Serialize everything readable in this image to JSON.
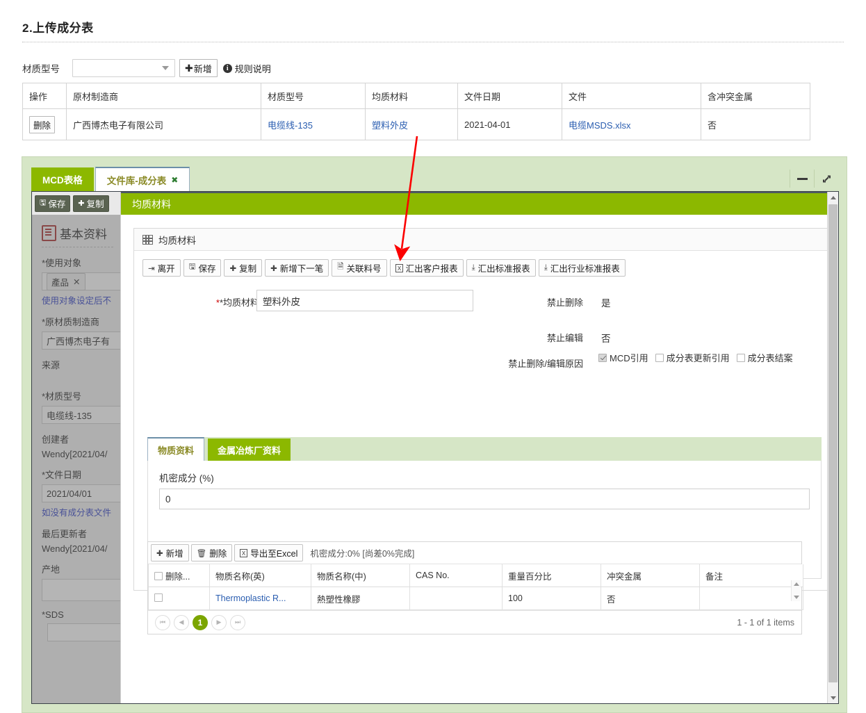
{
  "section": {
    "title": "2.上传成分表",
    "filter_label": "材质型号",
    "select_value": "",
    "add_button": "新增",
    "rule_link": "规则说明"
  },
  "table": {
    "headers": [
      "操作",
      "原材制造商",
      "材质型号",
      "均质材料",
      "文件日期",
      "文件",
      "含冲突金属"
    ],
    "rows": [
      {
        "action": "删除",
        "manufacturer": "广西博杰电子有限公司",
        "model": "电缆线-135",
        "material": "塑料外皮",
        "date": "2021-04-01",
        "file": "电缆MSDS.xlsx",
        "conflict": "否"
      }
    ]
  },
  "window": {
    "tabs": [
      {
        "label": "MCD表格",
        "active": false,
        "closable": false
      },
      {
        "label": "文件库-成分表",
        "active": true,
        "closable": true,
        "close_label": "✖"
      }
    ],
    "minimize_label": "最小化",
    "maximize_label": "最大化"
  },
  "left_form": {
    "save_button": "保存",
    "copy_button": "复制",
    "heading": "基本资料",
    "fields": [
      {
        "label": "*使用对象",
        "chip": "產品",
        "note": "使用对象设定后不"
      },
      {
        "label": "*原材质制造商",
        "value": "广西博杰电子有"
      },
      {
        "label": "来源",
        "value": ""
      },
      {
        "label": "*材质型号",
        "value": "电缆线-135"
      },
      {
        "label": "创建者",
        "value": "Wendy[2021/04/"
      },
      {
        "label": "*文件日期",
        "value": "2021/04/01",
        "note": "如没有成分表文件"
      },
      {
        "label": "最后更新者",
        "value": "Wendy[2021/04/"
      },
      {
        "label": "产地",
        "value": ""
      },
      {
        "label": "*SDS",
        "value": ""
      }
    ]
  },
  "modal": {
    "header": "均质材料",
    "card_title": "均质材料",
    "toolbar": [
      {
        "label": "离开",
        "icon": "exit-icon"
      },
      {
        "label": "保存",
        "icon": "save-icon"
      },
      {
        "label": "复制",
        "icon": "plus-icon"
      },
      {
        "label": "新增下一笔",
        "icon": "plus-icon"
      },
      {
        "label": "关联料号",
        "icon": "link-doc-icon"
      },
      {
        "label": "汇出客户报表",
        "icon": "excel-icon"
      },
      {
        "label": "汇出标准报表",
        "icon": "download-icon"
      },
      {
        "label": "汇出行业标准报表",
        "icon": "download-icon"
      }
    ],
    "form": {
      "material_label": "*均质材料",
      "material_value": "塑料外皮",
      "no_delete_label": "禁止删除",
      "no_delete_value": "是",
      "no_edit_label": "禁止编辑",
      "no_edit_value": "否",
      "reason_label": "禁止删除/编辑原因",
      "reasons": [
        {
          "label": "MCD引用",
          "checked": true
        },
        {
          "label": "成分表更新引用",
          "checked": false
        },
        {
          "label": "成分表结案",
          "checked": false
        }
      ]
    },
    "inner_tabs": [
      {
        "label": "物质资料",
        "active": true
      },
      {
        "label": "金属冶炼厂资料",
        "active": false
      }
    ],
    "confidential": {
      "label": "机密成分 (%)",
      "value": "0"
    },
    "grid": {
      "toolbar": [
        {
          "label": "新增",
          "icon": "plus-icon"
        },
        {
          "label": "删除",
          "icon": "trash-icon"
        },
        {
          "label": "导出至Excel",
          "icon": "excel-icon"
        }
      ],
      "status": "机密成分:0% [尚差0%完成]",
      "headers": [
        "删除...",
        "物质名称(英)",
        "物质名称(中)",
        "CAS No.",
        "重量百分比",
        "冲突金属",
        "备注"
      ],
      "rows": [
        {
          "checked": false,
          "name_en": "Thermoplastic R...",
          "name_cn": "熱塑性橡膠",
          "cas": "",
          "weight": "100",
          "conflict": "否",
          "remark": ""
        }
      ],
      "pager": {
        "first": "⏮",
        "prev": "◀",
        "current": "1",
        "next": "▶",
        "last": "⏭",
        "info": "1 - 1 of 1 items"
      }
    }
  },
  "annotation": {
    "color": "#fb0000",
    "from_label": "塑料外皮",
    "to_label": "均质材料"
  }
}
